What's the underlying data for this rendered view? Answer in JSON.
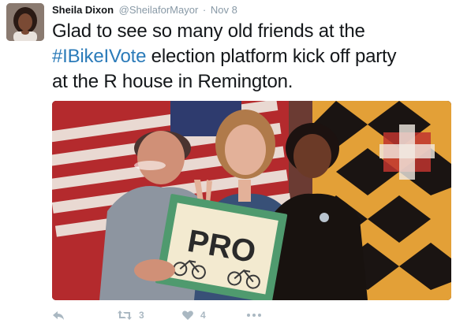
{
  "tweet": {
    "author_name": "Sheila Dixon",
    "author_handle": "@SheilaforMayor",
    "separator": "·",
    "timestamp": "Nov 8",
    "text_line1": "Glad to see so many old friends at the",
    "hashtag": "#IBikeIVote",
    "text_after_hashtag": " election platform kick off party",
    "text_line3": "at the R house in Remington.",
    "photo_sign_text": "PRO",
    "actions": {
      "retweet_count": "3",
      "like_count": "4"
    }
  },
  "colors": {
    "hashtag": "#2b7bb9",
    "meta_gray": "#8899a6",
    "action_gray": "#aab8c2"
  },
  "icons": [
    "reply-icon",
    "retweet-icon",
    "heart-icon",
    "more-icon"
  ]
}
